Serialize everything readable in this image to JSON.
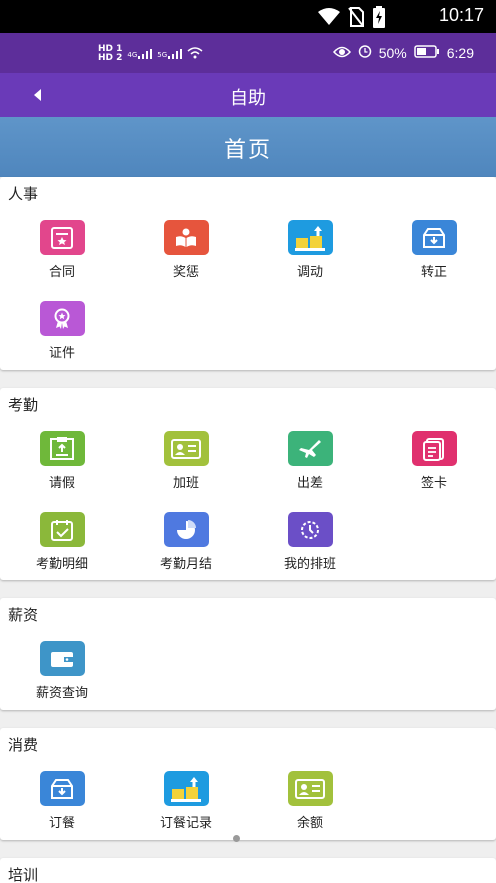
{
  "system_bar": {
    "time": "10:17",
    "icons": [
      "wifi-icon",
      "no-sim-icon",
      "battery-charging-icon"
    ]
  },
  "phone_status": {
    "left_icons": [
      "hd-signal-icon",
      "signal-4g-icon",
      "signal-5g-icon",
      "wifi-icon"
    ],
    "hd1": "HD 1",
    "hd2": "HD 2",
    "net1": "4G",
    "net2": "5G",
    "battery_percent": "50%",
    "time": "6:29"
  },
  "title_bar": {
    "back_icon": "back-arrow-icon",
    "title": "自助"
  },
  "banner": {
    "title": "首页"
  },
  "sections": [
    {
      "title": "人事",
      "items": [
        {
          "label": "合同",
          "icon": "contract-icon",
          "color": "#e2468c"
        },
        {
          "label": "奖惩",
          "icon": "reward-book-icon",
          "color": "#e6553d"
        },
        {
          "label": "调动",
          "icon": "transfer-icon",
          "color": "#1e9be0"
        },
        {
          "label": "转正",
          "icon": "regularize-icon",
          "color": "#3a86d8"
        },
        {
          "label": "证件",
          "icon": "certificate-icon",
          "color": "#b958d6"
        }
      ]
    },
    {
      "title": "考勤",
      "items": [
        {
          "label": "请假",
          "icon": "leave-icon",
          "color": "#6fb83a"
        },
        {
          "label": "加班",
          "icon": "overtime-icon",
          "color": "#a2c13c"
        },
        {
          "label": "出差",
          "icon": "trip-plane-icon",
          "color": "#3cb37a"
        },
        {
          "label": "签卡",
          "icon": "sign-card-icon",
          "color": "#e0306e"
        },
        {
          "label": "考勤明细",
          "icon": "attendance-detail-icon",
          "color": "#8bb83a"
        },
        {
          "label": "考勤月结",
          "icon": "monthly-pie-icon",
          "color": "#4f79e0"
        },
        {
          "label": "我的排班",
          "icon": "schedule-clock-icon",
          "color": "#6b4fc7"
        }
      ]
    },
    {
      "title": "薪资",
      "items": [
        {
          "label": "薪资查询",
          "icon": "wallet-icon",
          "color": "#3e95c8"
        }
      ]
    },
    {
      "title": "消费",
      "items": [
        {
          "label": "订餐",
          "icon": "order-tray-icon",
          "color": "#3a86d8"
        },
        {
          "label": "订餐记录",
          "icon": "order-record-icon",
          "color": "#1e9be0"
        },
        {
          "label": "余额",
          "icon": "balance-card-icon",
          "color": "#a2c13c"
        }
      ]
    },
    {
      "title": "培训",
      "items": []
    }
  ]
}
